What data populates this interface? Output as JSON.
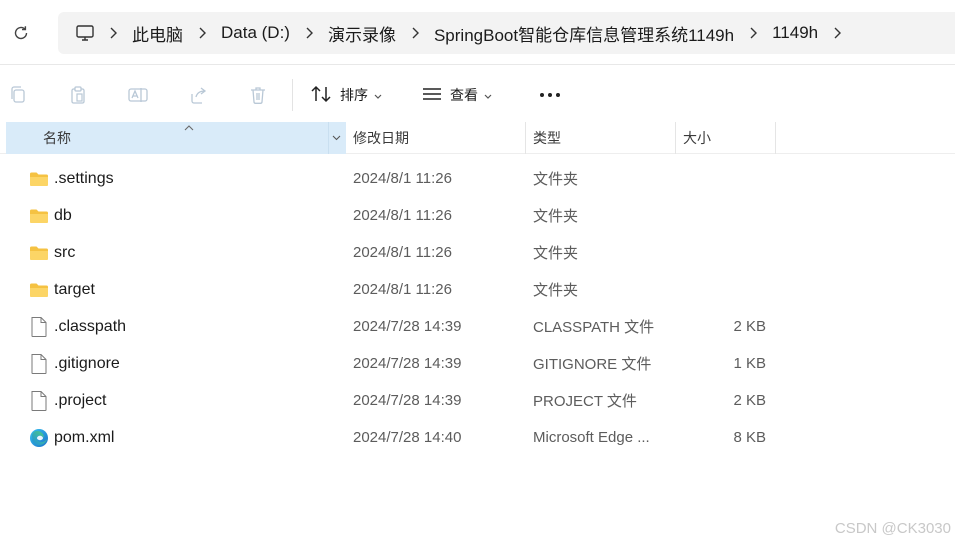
{
  "address_bar": {
    "breadcrumbs": [
      "此电脑",
      "Data (D:)",
      "演示录像",
      "SpringBoot智能仓库信息管理系统1149h",
      "1149h"
    ]
  },
  "toolbar": {
    "sort_label": "排序",
    "view_label": "查看"
  },
  "columns": {
    "name": "名称",
    "date": "修改日期",
    "type": "类型",
    "size": "大小"
  },
  "files": [
    {
      "name": ".settings",
      "date": "2024/8/1 11:26",
      "type": "文件夹",
      "size": "",
      "icon": "folder-icon"
    },
    {
      "name": "db",
      "date": "2024/8/1 11:26",
      "type": "文件夹",
      "size": "",
      "icon": "folder-icon"
    },
    {
      "name": "src",
      "date": "2024/8/1 11:26",
      "type": "文件夹",
      "size": "",
      "icon": "folder-icon"
    },
    {
      "name": "target",
      "date": "2024/8/1 11:26",
      "type": "文件夹",
      "size": "",
      "icon": "folder-icon"
    },
    {
      "name": ".classpath",
      "date": "2024/7/28 14:39",
      "type": "CLASSPATH 文件",
      "size": "2 KB",
      "icon": "file-icon"
    },
    {
      "name": ".gitignore",
      "date": "2024/7/28 14:39",
      "type": "GITIGNORE 文件",
      "size": "1 KB",
      "icon": "file-icon"
    },
    {
      "name": ".project",
      "date": "2024/7/28 14:39",
      "type": "PROJECT 文件",
      "size": "2 KB",
      "icon": "file-icon"
    },
    {
      "name": "pom.xml",
      "date": "2024/7/28 14:40",
      "type": "Microsoft Edge ...",
      "size": "8 KB",
      "icon": "edge-icon"
    }
  ],
  "watermark": "CSDN @CK3030",
  "colors": {
    "header_highlight": "#d9ebf9",
    "folder": "#f5c242",
    "address_bg": "#f3f3f3"
  }
}
